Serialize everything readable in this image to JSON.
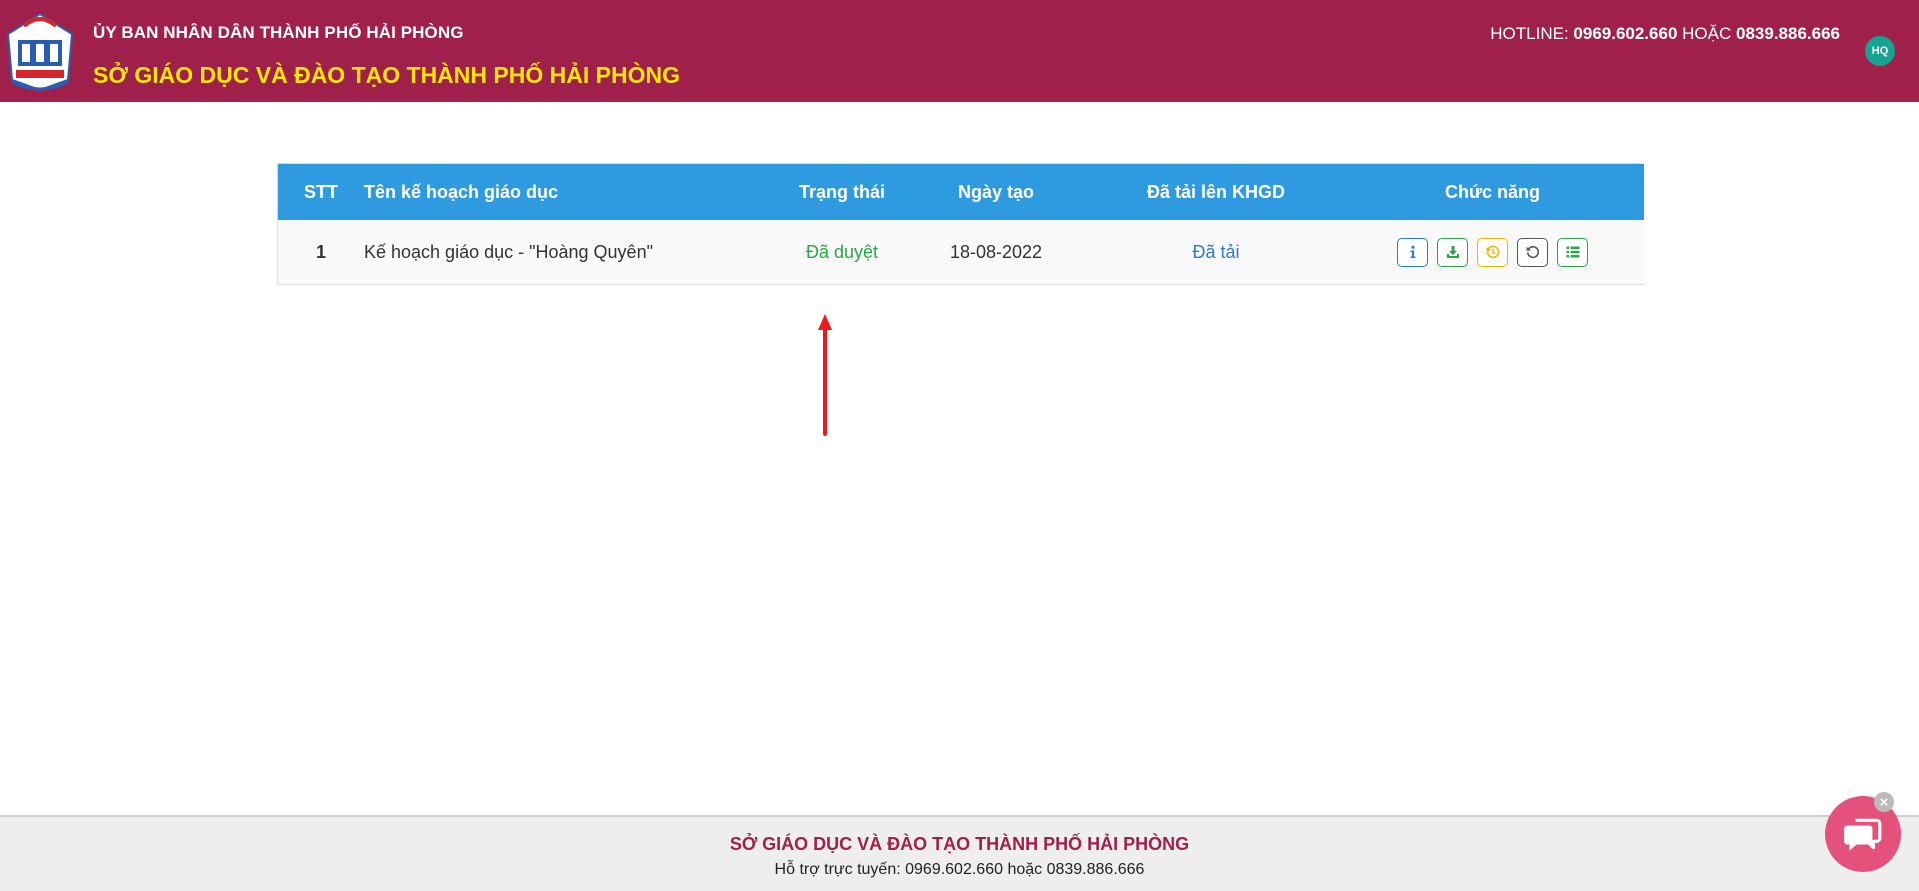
{
  "header": {
    "org_small": "ỦY BAN NHÂN DÂN THÀNH PHỐ HẢI PHÒNG",
    "org_big": "SỞ GIÁO DỤC VÀ ĐÀO TẠO THÀNH PHỐ HẢI PHÒNG",
    "hotline_label": "HOTLINE:",
    "hotline_1": "0969.602.660",
    "hotline_or": "HOẶC",
    "hotline_2": "0839.886.666",
    "avatar_initials": "HQ",
    "logo_icon": "school-logo-icon"
  },
  "table": {
    "columns": [
      "STT",
      "Tên kế hoạch giáo dục",
      "Trạng thái",
      "Ngày tạo",
      "Đã tải lên KHGD",
      "Chức năng"
    ],
    "rows": [
      {
        "stt": "1",
        "name": "Kế hoạch giáo dục - \"Hoàng Quyên\"",
        "status": "Đã duyệt",
        "created": "18-08-2022",
        "uploaded": "Đã tải",
        "actions": [
          "info-icon",
          "download-icon",
          "history-icon",
          "undo-icon",
          "list-icon"
        ]
      }
    ]
  },
  "footer": {
    "title": "SỞ GIÁO DỤC VÀ ĐÀO TẠO THÀNH PHỐ HẢI PHÒNG",
    "support": "Hỗ trợ trực tuyến: 0969.602.660 hoặc 0839.886.666"
  },
  "colors": {
    "brand": "#a0204c",
    "header_title": "#ffe600",
    "table_header": "#2e9be0",
    "status_ok": "#28a745",
    "link": "#2e7ad1",
    "chat": "#e4527b"
  }
}
